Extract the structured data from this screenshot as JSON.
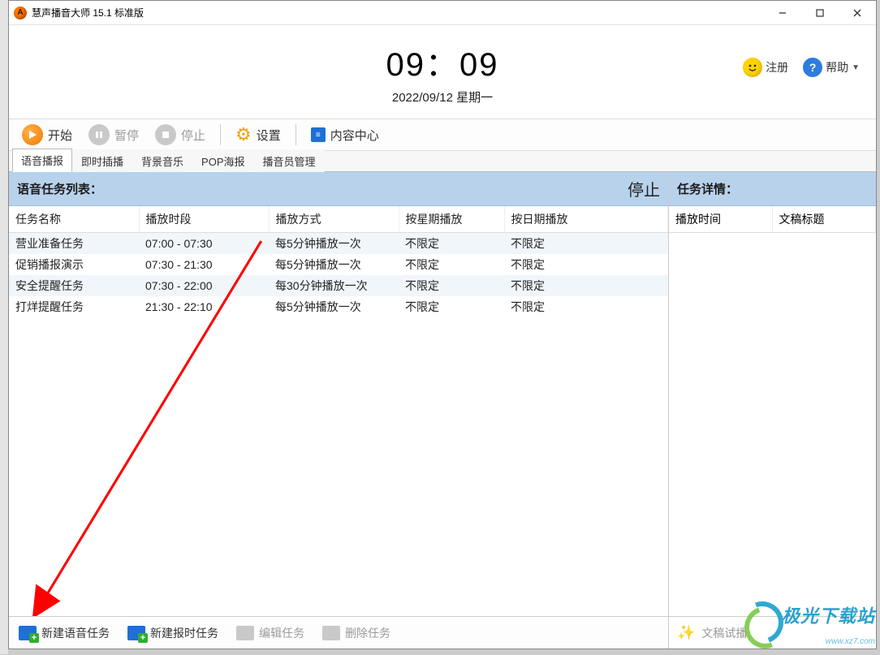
{
  "window": {
    "title": "慧声播音大师 15.1 标准版"
  },
  "clock": {
    "time": "09：09",
    "date": "2022/09/12 星期一"
  },
  "header_links": {
    "register": "注册",
    "help": "帮助"
  },
  "toolbar": {
    "start": "开始",
    "pause": "暂停",
    "stop": "停止",
    "settings": "设置",
    "content_center": "内容中心"
  },
  "tabs": [
    {
      "label": "语音播报",
      "active": true
    },
    {
      "label": "即时插播",
      "active": false
    },
    {
      "label": "背景音乐",
      "active": false
    },
    {
      "label": "POP海报",
      "active": false
    },
    {
      "label": "播音员管理",
      "active": false
    }
  ],
  "task_list": {
    "title": "语音任务列表：",
    "status": "停止",
    "columns": [
      "任务名称",
      "播放时段",
      "播放方式",
      "按星期播放",
      "按日期播放"
    ],
    "rows": [
      {
        "name": "营业准备任务",
        "period": "07:00 - 07:30",
        "mode": "每5分钟播放一次",
        "by_week": "不限定",
        "by_date": "不限定"
      },
      {
        "name": "促销播报演示",
        "period": "07:30 - 21:30",
        "mode": "每5分钟播放一次",
        "by_week": "不限定",
        "by_date": "不限定"
      },
      {
        "name": "安全提醒任务",
        "period": "07:30 - 22:00",
        "mode": "每30分钟播放一次",
        "by_week": "不限定",
        "by_date": "不限定"
      },
      {
        "name": "打烊提醒任务",
        "period": "21:30 - 22:10",
        "mode": "每5分钟播放一次",
        "by_week": "不限定",
        "by_date": "不限定"
      }
    ]
  },
  "details": {
    "title": "任务详情：",
    "columns": [
      "播放时间",
      "文稿标题"
    ]
  },
  "bottom": {
    "new_voice": "新建语音任务",
    "new_time": "新建报时任务",
    "edit": "编辑任务",
    "delete": "删除任务",
    "preview": "文稿试播"
  },
  "watermark": {
    "name": "极光下载站",
    "url": "www.xz7.com"
  }
}
